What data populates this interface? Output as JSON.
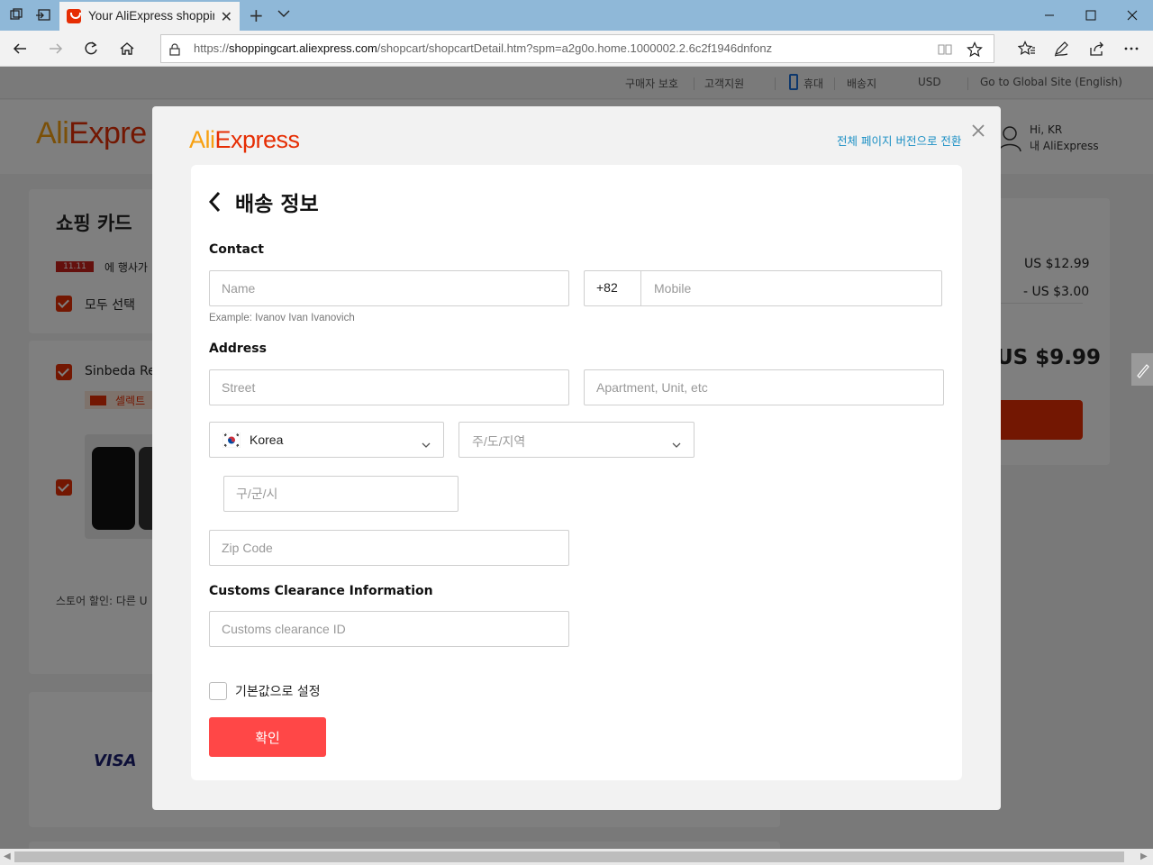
{
  "browser": {
    "tab_title": "Your AliExpress shoppin",
    "url_prefix": "https://",
    "url_host": "shoppingcart.aliexpress.com",
    "url_path": "/shopcart/shopcartDetail.htm?spm=a2g0o.home.1000002.2.6c2f1946dnfonz"
  },
  "background_page": {
    "topbar": {
      "buyer_protection": "구매자 보호",
      "customer_service": "고객지원",
      "mobile": "휴대",
      "ship_to": "배송지",
      "currency": "USD",
      "global_site": "Go to Global Site (English)"
    },
    "logo": {
      "part1": "Ali",
      "part2": "Expre"
    },
    "user": {
      "greeting": "Hi, KR",
      "my_ali": "내 AliExpress"
    },
    "cart_title": "쇼핑 카드",
    "promo_badge": "11.11",
    "promo_text": "에 행사가",
    "select_all": "모두 선택",
    "store_name": "Sinbeda Rep",
    "choice_tag": "셀렉트",
    "store_discount": "스토어 할인: 다른 U",
    "summary": {
      "subtotal": "US $12.99",
      "discount": "- US $3.00",
      "total": "US $9.99"
    },
    "payment_visa": "VISA"
  },
  "modal": {
    "logo": {
      "part1": "Ali",
      "part2": "Express"
    },
    "switch_link": "전체 페이지 버전으로 전환",
    "title": "배송 정보",
    "contact_label": "Contact",
    "name_placeholder": "Name",
    "name_hint": "Example: Ivanov Ivan Ivanovich",
    "phone_code": "+82",
    "mobile_placeholder": "Mobile",
    "address_label": "Address",
    "street_placeholder": "Street",
    "apartment_placeholder": "Apartment, Unit, etc",
    "country_value": "Korea",
    "province_placeholder": "주/도/지역",
    "city_placeholder": "구/군/시",
    "zip_placeholder": "Zip Code",
    "customs_label": "Customs Clearance Information",
    "customs_placeholder": "Customs clearance ID",
    "default_checkbox_label": "기본값으로 설정",
    "default_checked": false,
    "confirm_label": "확인"
  },
  "colors": {
    "accent": "#ff4747",
    "brand_orange": "#f7a011",
    "brand_red": "#e62e04",
    "link": "#1a8fc4"
  },
  "icons": [
    "tab-actions-icon",
    "set-aside-icon",
    "close-icon",
    "new-tab-icon",
    "chevron-down-icon",
    "minimize-icon",
    "maximize-icon",
    "back-icon",
    "forward-icon",
    "refresh-icon",
    "home-icon",
    "lock-icon",
    "reading-view-icon",
    "favorite-star-icon",
    "favorites-icon",
    "pen-icon",
    "share-icon",
    "more-icon",
    "user-icon",
    "flag-korea-icon"
  ]
}
